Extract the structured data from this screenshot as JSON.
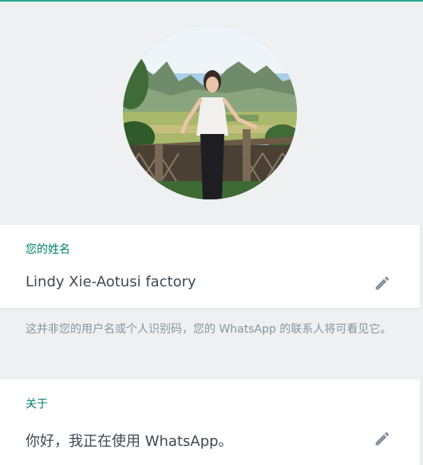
{
  "profile": {
    "name_label": "您的姓名",
    "name_value": "Lindy Xie-Aotusi factory",
    "name_hint": "这并非您的用户名或个人识别码，您的 WhatsApp 的联系人将可看见它。",
    "about_label": "关于",
    "about_value": "你好，我正在使用 WhatsApp。"
  },
  "icons": {
    "edit": "pencil-icon"
  },
  "colors": {
    "accent": "#008069",
    "top_bar": "#27a58c",
    "background": "#eef0f2",
    "text_primary": "#3b4a54",
    "text_secondary": "#8696a0",
    "icon": "#8696a0"
  }
}
